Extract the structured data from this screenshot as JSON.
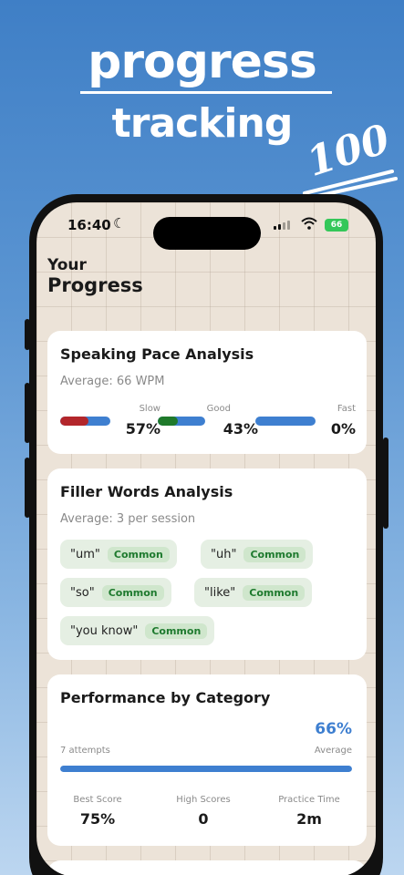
{
  "promo": {
    "line1": "progress",
    "line2": "tracking",
    "sticker": "100"
  },
  "status_bar": {
    "time": "16:40",
    "battery": "66"
  },
  "page": {
    "title_small": "Your",
    "title_large": "Progress"
  },
  "pace_card": {
    "title": "Speaking Pace Analysis",
    "average": "Average: 66 WPM",
    "segments": [
      {
        "label": "Slow",
        "value": "57%",
        "fill": 0.57,
        "fill_color": "#b3262b"
      },
      {
        "label": "Good",
        "value": "43%",
        "fill": 0.43,
        "fill_color": "#1f7a2b"
      },
      {
        "label": "Fast",
        "value": "0%",
        "fill": 0.0,
        "fill_color": "#3e7fd0"
      }
    ]
  },
  "filler_card": {
    "title": "Filler Words Analysis",
    "average": "Average: 3 per session",
    "words": [
      {
        "word": "\"um\"",
        "badge": "Common"
      },
      {
        "word": "\"uh\"",
        "badge": "Common"
      },
      {
        "word": "\"so\"",
        "badge": "Common"
      },
      {
        "word": "\"like\"",
        "badge": "Common"
      },
      {
        "word": "\"you know\"",
        "badge": "Common"
      }
    ]
  },
  "performance_card": {
    "title": "Performance by Category",
    "percent": "66%",
    "progress": 1.0,
    "attempts": "7 attempts",
    "average_label": "Average",
    "stats": [
      {
        "label": "Best Score",
        "value": "75%"
      },
      {
        "label": "High Scores",
        "value": "0"
      },
      {
        "label": "Practice Time",
        "value": "2m"
      }
    ]
  },
  "colors": {
    "accent": "#3e7fd0",
    "badge_green": "#1e7a2e",
    "background_top": "#3f7fc6"
  }
}
